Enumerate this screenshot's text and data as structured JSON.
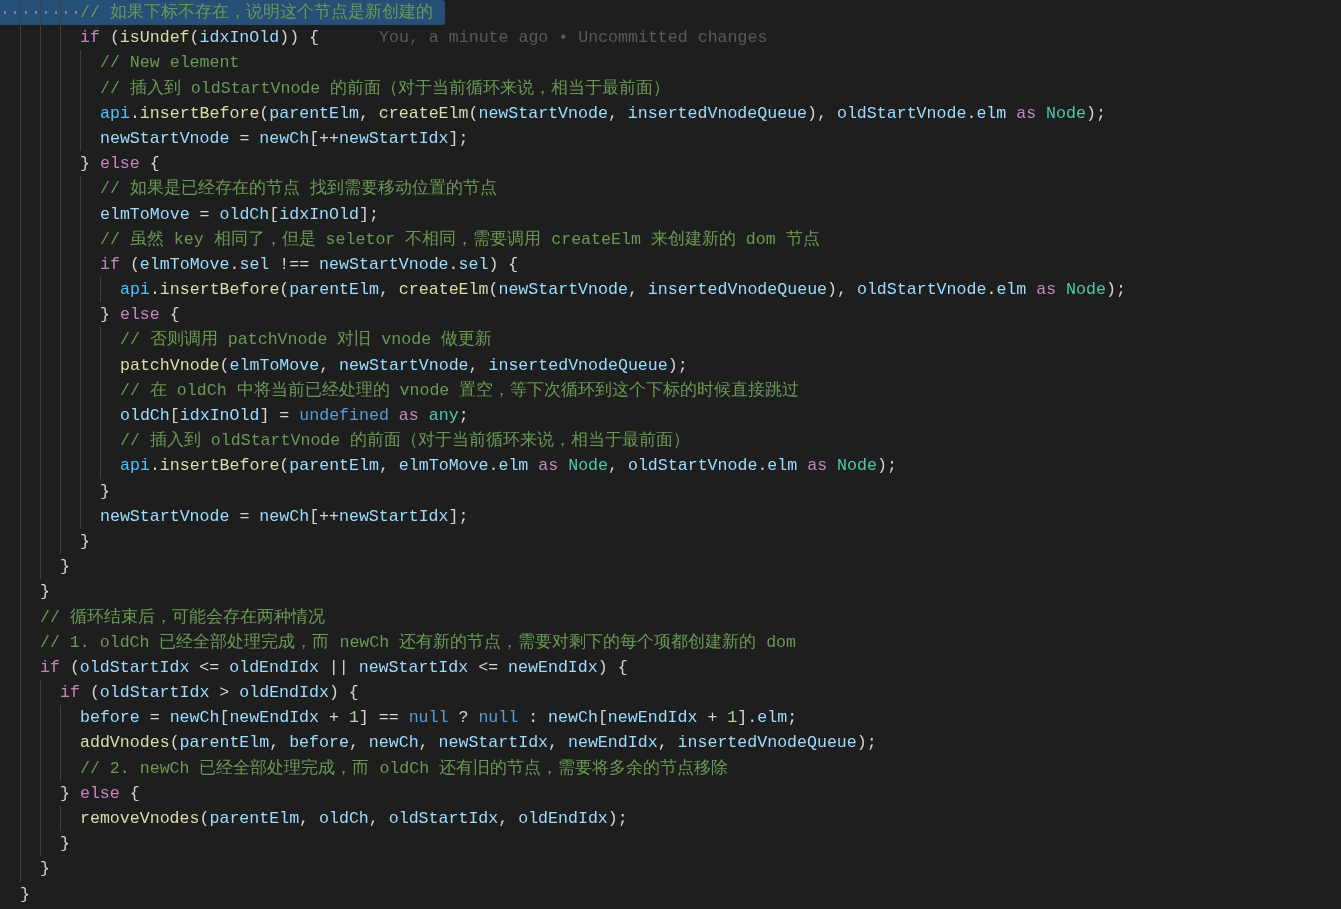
{
  "editor": {
    "lines": [
      {
        "selected": true,
        "tokens": [
          {
            "kind": "comment",
            "text": "        // 如果下标不存在，说明这个节点是新创建的"
          }
        ]
      },
      {
        "selected": false,
        "blame": "You, a minute ago • Uncommitted changes",
        "tokens": [
          {
            "kind": "keyword",
            "text": "        if"
          },
          {
            "kind": "punct",
            "text": " ("
          },
          {
            "kind": "function",
            "text": "isUndef"
          },
          {
            "kind": "punct",
            "text": "("
          },
          {
            "kind": "variable",
            "text": "idxInOld"
          },
          {
            "kind": "punct",
            "text": ")) {"
          }
        ]
      },
      {
        "selected": false,
        "tokens": [
          {
            "kind": "comment",
            "text": "          // New element"
          }
        ]
      },
      {
        "selected": false,
        "tokens": [
          {
            "kind": "comment",
            "text": "          // 插入到 oldStartVnode 的前面（对于当前循环来说，相当于最前面）"
          }
        ]
      },
      {
        "selected": false,
        "tokens": [
          {
            "kind": "constant",
            "text": "          api"
          },
          {
            "kind": "punct",
            "text": "."
          },
          {
            "kind": "function",
            "text": "insertBefore"
          },
          {
            "kind": "punct",
            "text": "("
          },
          {
            "kind": "variable",
            "text": "parentElm"
          },
          {
            "kind": "punct",
            "text": ", "
          },
          {
            "kind": "function",
            "text": "createElm"
          },
          {
            "kind": "punct",
            "text": "("
          },
          {
            "kind": "variable",
            "text": "newStartVnode"
          },
          {
            "kind": "punct",
            "text": ", "
          },
          {
            "kind": "variable",
            "text": "insertedVnodeQueue"
          },
          {
            "kind": "punct",
            "text": "), "
          },
          {
            "kind": "variable",
            "text": "oldStartVnode"
          },
          {
            "kind": "punct",
            "text": "."
          },
          {
            "kind": "variable",
            "text": "elm"
          },
          {
            "kind": "keyword",
            "text": " as "
          },
          {
            "kind": "type",
            "text": "Node"
          },
          {
            "kind": "punct",
            "text": ");"
          }
        ]
      },
      {
        "selected": false,
        "tokens": [
          {
            "kind": "variable",
            "text": "          newStartVnode"
          },
          {
            "kind": "punct",
            "text": " = "
          },
          {
            "kind": "variable",
            "text": "newCh"
          },
          {
            "kind": "punct",
            "text": "[++"
          },
          {
            "kind": "variable",
            "text": "newStartIdx"
          },
          {
            "kind": "punct",
            "text": "];"
          }
        ]
      },
      {
        "selected": false,
        "tokens": [
          {
            "kind": "punct",
            "text": "        } "
          },
          {
            "kind": "keyword",
            "text": "else"
          },
          {
            "kind": "punct",
            "text": " {"
          }
        ]
      },
      {
        "selected": false,
        "tokens": [
          {
            "kind": "comment",
            "text": "          // 如果是已经存在的节点 找到需要移动位置的节点"
          }
        ]
      },
      {
        "selected": false,
        "tokens": [
          {
            "kind": "variable",
            "text": "          elmToMove"
          },
          {
            "kind": "punct",
            "text": " = "
          },
          {
            "kind": "variable",
            "text": "oldCh"
          },
          {
            "kind": "punct",
            "text": "["
          },
          {
            "kind": "variable",
            "text": "idxInOld"
          },
          {
            "kind": "punct",
            "text": "];"
          }
        ]
      },
      {
        "selected": false,
        "tokens": [
          {
            "kind": "comment",
            "text": "          // 虽然 key 相同了，但是 seletor 不相同，需要调用 createElm 来创建新的 dom 节点"
          }
        ]
      },
      {
        "selected": false,
        "tokens": [
          {
            "kind": "keyword",
            "text": "          if"
          },
          {
            "kind": "punct",
            "text": " ("
          },
          {
            "kind": "variable",
            "text": "elmToMove"
          },
          {
            "kind": "punct",
            "text": "."
          },
          {
            "kind": "variable",
            "text": "sel"
          },
          {
            "kind": "punct",
            "text": " !== "
          },
          {
            "kind": "variable",
            "text": "newStartVnode"
          },
          {
            "kind": "punct",
            "text": "."
          },
          {
            "kind": "variable",
            "text": "sel"
          },
          {
            "kind": "punct",
            "text": ") {"
          }
        ]
      },
      {
        "selected": false,
        "tokens": [
          {
            "kind": "constant",
            "text": "            api"
          },
          {
            "kind": "punct",
            "text": "."
          },
          {
            "kind": "function",
            "text": "insertBefore"
          },
          {
            "kind": "punct",
            "text": "("
          },
          {
            "kind": "variable",
            "text": "parentElm"
          },
          {
            "kind": "punct",
            "text": ", "
          },
          {
            "kind": "function",
            "text": "createElm"
          },
          {
            "kind": "punct",
            "text": "("
          },
          {
            "kind": "variable",
            "text": "newStartVnode"
          },
          {
            "kind": "punct",
            "text": ", "
          },
          {
            "kind": "variable",
            "text": "insertedVnodeQueue"
          },
          {
            "kind": "punct",
            "text": "), "
          },
          {
            "kind": "variable",
            "text": "oldStartVnode"
          },
          {
            "kind": "punct",
            "text": "."
          },
          {
            "kind": "variable",
            "text": "elm"
          },
          {
            "kind": "keyword",
            "text": " as "
          },
          {
            "kind": "type",
            "text": "Node"
          },
          {
            "kind": "punct",
            "text": ");"
          }
        ]
      },
      {
        "selected": false,
        "tokens": [
          {
            "kind": "punct",
            "text": "          } "
          },
          {
            "kind": "keyword",
            "text": "else"
          },
          {
            "kind": "punct",
            "text": " {"
          }
        ]
      },
      {
        "selected": false,
        "tokens": [
          {
            "kind": "comment",
            "text": "            // 否则调用 patchVnode 对旧 vnode 做更新"
          }
        ]
      },
      {
        "selected": false,
        "tokens": [
          {
            "kind": "function",
            "text": "            patchVnode"
          },
          {
            "kind": "punct",
            "text": "("
          },
          {
            "kind": "variable",
            "text": "elmToMove"
          },
          {
            "kind": "punct",
            "text": ", "
          },
          {
            "kind": "variable",
            "text": "newStartVnode"
          },
          {
            "kind": "punct",
            "text": ", "
          },
          {
            "kind": "variable",
            "text": "insertedVnodeQueue"
          },
          {
            "kind": "punct",
            "text": ");"
          }
        ]
      },
      {
        "selected": false,
        "tokens": [
          {
            "kind": "comment",
            "text": "            // 在 oldCh 中将当前已经处理的 vnode 置空，等下次循环到这个下标的时候直接跳过"
          }
        ]
      },
      {
        "selected": false,
        "tokens": [
          {
            "kind": "variable",
            "text": "            oldCh"
          },
          {
            "kind": "punct",
            "text": "["
          },
          {
            "kind": "variable",
            "text": "idxInOld"
          },
          {
            "kind": "punct",
            "text": "] = "
          },
          {
            "kind": "literal",
            "text": "undefined"
          },
          {
            "kind": "keyword",
            "text": " as "
          },
          {
            "kind": "type",
            "text": "any"
          },
          {
            "kind": "punct",
            "text": ";"
          }
        ]
      },
      {
        "selected": false,
        "tokens": [
          {
            "kind": "comment",
            "text": "            // 插入到 oldStartVnode 的前面（对于当前循环来说，相当于最前面）"
          }
        ]
      },
      {
        "selected": false,
        "tokens": [
          {
            "kind": "constant",
            "text": "            api"
          },
          {
            "kind": "punct",
            "text": "."
          },
          {
            "kind": "function",
            "text": "insertBefore"
          },
          {
            "kind": "punct",
            "text": "("
          },
          {
            "kind": "variable",
            "text": "parentElm"
          },
          {
            "kind": "punct",
            "text": ", "
          },
          {
            "kind": "variable",
            "text": "elmToMove"
          },
          {
            "kind": "punct",
            "text": "."
          },
          {
            "kind": "variable",
            "text": "elm"
          },
          {
            "kind": "keyword",
            "text": " as "
          },
          {
            "kind": "type",
            "text": "Node"
          },
          {
            "kind": "punct",
            "text": ", "
          },
          {
            "kind": "variable",
            "text": "oldStartVnode"
          },
          {
            "kind": "punct",
            "text": "."
          },
          {
            "kind": "variable",
            "text": "elm"
          },
          {
            "kind": "keyword",
            "text": " as "
          },
          {
            "kind": "type",
            "text": "Node"
          },
          {
            "kind": "punct",
            "text": ");"
          }
        ]
      },
      {
        "selected": false,
        "tokens": [
          {
            "kind": "punct",
            "text": "          }"
          }
        ]
      },
      {
        "selected": false,
        "tokens": [
          {
            "kind": "variable",
            "text": "          newStartVnode"
          },
          {
            "kind": "punct",
            "text": " = "
          },
          {
            "kind": "variable",
            "text": "newCh"
          },
          {
            "kind": "punct",
            "text": "[++"
          },
          {
            "kind": "variable",
            "text": "newStartIdx"
          },
          {
            "kind": "punct",
            "text": "];"
          }
        ]
      },
      {
        "selected": false,
        "tokens": [
          {
            "kind": "punct",
            "text": "        }"
          }
        ]
      },
      {
        "selected": false,
        "tokens": [
          {
            "kind": "punct",
            "text": "      }"
          }
        ]
      },
      {
        "selected": false,
        "tokens": [
          {
            "kind": "punct",
            "text": "    }"
          }
        ]
      },
      {
        "selected": false,
        "tokens": [
          {
            "kind": "comment",
            "text": "    // 循环结束后，可能会存在两种情况"
          }
        ]
      },
      {
        "selected": false,
        "tokens": [
          {
            "kind": "comment",
            "text": "    // 1. oldCh 已经全部处理完成，而 newCh 还有新的节点，需要对剩下的每个项都创建新的 dom"
          }
        ]
      },
      {
        "selected": false,
        "tokens": [
          {
            "kind": "keyword",
            "text": "    if"
          },
          {
            "kind": "punct",
            "text": " ("
          },
          {
            "kind": "variable",
            "text": "oldStartIdx"
          },
          {
            "kind": "punct",
            "text": " <= "
          },
          {
            "kind": "variable",
            "text": "oldEndIdx"
          },
          {
            "kind": "punct",
            "text": " || "
          },
          {
            "kind": "variable",
            "text": "newStartIdx"
          },
          {
            "kind": "punct",
            "text": " <= "
          },
          {
            "kind": "variable",
            "text": "newEndIdx"
          },
          {
            "kind": "punct",
            "text": ") {"
          }
        ]
      },
      {
        "selected": false,
        "tokens": [
          {
            "kind": "keyword",
            "text": "      if"
          },
          {
            "kind": "punct",
            "text": " ("
          },
          {
            "kind": "variable",
            "text": "oldStartIdx"
          },
          {
            "kind": "punct",
            "text": " > "
          },
          {
            "kind": "variable",
            "text": "oldEndIdx"
          },
          {
            "kind": "punct",
            "text": ") {"
          }
        ]
      },
      {
        "selected": false,
        "tokens": [
          {
            "kind": "variable",
            "text": "        before"
          },
          {
            "kind": "punct",
            "text": " = "
          },
          {
            "kind": "variable",
            "text": "newCh"
          },
          {
            "kind": "punct",
            "text": "["
          },
          {
            "kind": "variable",
            "text": "newEndIdx"
          },
          {
            "kind": "punct",
            "text": " + "
          },
          {
            "kind": "number",
            "text": "1"
          },
          {
            "kind": "punct",
            "text": "] == "
          },
          {
            "kind": "literal",
            "text": "null"
          },
          {
            "kind": "punct",
            "text": " ? "
          },
          {
            "kind": "literal",
            "text": "null"
          },
          {
            "kind": "punct",
            "text": " : "
          },
          {
            "kind": "variable",
            "text": "newCh"
          },
          {
            "kind": "punct",
            "text": "["
          },
          {
            "kind": "variable",
            "text": "newEndIdx"
          },
          {
            "kind": "punct",
            "text": " + "
          },
          {
            "kind": "number",
            "text": "1"
          },
          {
            "kind": "punct",
            "text": "]."
          },
          {
            "kind": "variable",
            "text": "elm"
          },
          {
            "kind": "punct",
            "text": ";"
          }
        ]
      },
      {
        "selected": false,
        "tokens": [
          {
            "kind": "function",
            "text": "        addVnodes"
          },
          {
            "kind": "punct",
            "text": "("
          },
          {
            "kind": "variable",
            "text": "parentElm"
          },
          {
            "kind": "punct",
            "text": ", "
          },
          {
            "kind": "variable",
            "text": "before"
          },
          {
            "kind": "punct",
            "text": ", "
          },
          {
            "kind": "variable",
            "text": "newCh"
          },
          {
            "kind": "punct",
            "text": ", "
          },
          {
            "kind": "variable",
            "text": "newStartIdx"
          },
          {
            "kind": "punct",
            "text": ", "
          },
          {
            "kind": "variable",
            "text": "newEndIdx"
          },
          {
            "kind": "punct",
            "text": ", "
          },
          {
            "kind": "variable",
            "text": "insertedVnodeQueue"
          },
          {
            "kind": "punct",
            "text": ");"
          }
        ]
      },
      {
        "selected": false,
        "tokens": [
          {
            "kind": "comment",
            "text": "        // 2. newCh 已经全部处理完成，而 oldCh 还有旧的节点，需要将多余的节点移除"
          }
        ]
      },
      {
        "selected": false,
        "tokens": [
          {
            "kind": "punct",
            "text": "      } "
          },
          {
            "kind": "keyword",
            "text": "else"
          },
          {
            "kind": "punct",
            "text": " {"
          }
        ]
      },
      {
        "selected": false,
        "tokens": [
          {
            "kind": "function",
            "text": "        removeVnodes"
          },
          {
            "kind": "punct",
            "text": "("
          },
          {
            "kind": "variable",
            "text": "parentElm"
          },
          {
            "kind": "punct",
            "text": ", "
          },
          {
            "kind": "variable",
            "text": "oldCh"
          },
          {
            "kind": "punct",
            "text": ", "
          },
          {
            "kind": "variable",
            "text": "oldStartIdx"
          },
          {
            "kind": "punct",
            "text": ", "
          },
          {
            "kind": "variable",
            "text": "oldEndIdx"
          },
          {
            "kind": "punct",
            "text": ");"
          }
        ]
      },
      {
        "selected": false,
        "tokens": [
          {
            "kind": "punct",
            "text": "      }"
          }
        ]
      },
      {
        "selected": false,
        "tokens": [
          {
            "kind": "punct",
            "text": "    }"
          }
        ]
      },
      {
        "selected": false,
        "tokens": [
          {
            "kind": "punct",
            "text": "  }"
          }
        ]
      }
    ]
  }
}
